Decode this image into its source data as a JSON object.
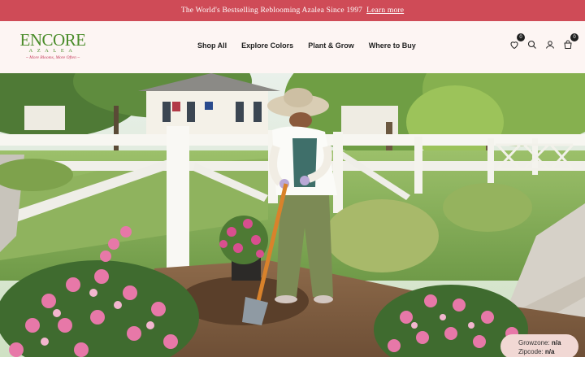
{
  "announcement": {
    "text": "The World's Bestselling Reblooming Azalea Since 1997",
    "link_label": "Learn more"
  },
  "brand": {
    "name": "ENCORE",
    "subname": "AZALEA",
    "tagline": "~ More Blooms, More Often ~"
  },
  "nav": {
    "items": [
      {
        "label": "Shop All"
      },
      {
        "label": "Explore Colors"
      },
      {
        "label": "Plant & Grow"
      },
      {
        "label": "Where to Buy"
      }
    ]
  },
  "header_icons": {
    "wishlist_count": "0",
    "cart_count": "0",
    "icons": [
      "heart-icon",
      "search-icon",
      "user-icon",
      "cart-icon"
    ]
  },
  "growzone": {
    "growzone_label": "Growzone:",
    "growzone_value": "n/a",
    "zipcode_label": "Zipcode:",
    "zipcode_value": "n/a"
  },
  "colors": {
    "announcement_bg": "#cf4b57",
    "header_bg": "#fdf5f3",
    "brand_green": "#4a8c2a",
    "brand_pink": "#c4395a",
    "pill_bg": "#f1d8d4"
  }
}
